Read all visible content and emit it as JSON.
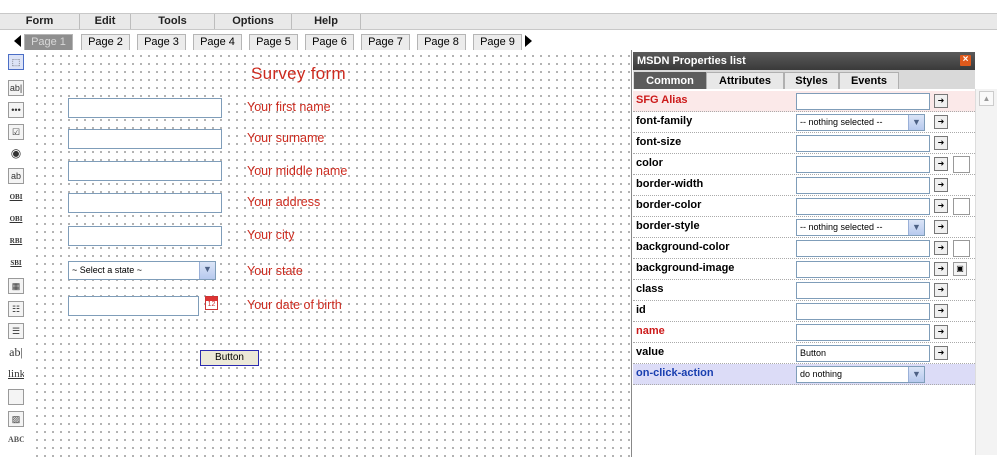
{
  "menu": [
    "Form",
    "Edit",
    "Tools",
    "Options",
    "Help"
  ],
  "pages": {
    "tabs": [
      "Page 1",
      "Page 2",
      "Page 3",
      "Page 4",
      "Page 5",
      "Page 6",
      "Page 7",
      "Page 8",
      "Page 9"
    ],
    "active": "Page 1"
  },
  "toolbox": {
    "icons": [
      "pointer-icon",
      "textbox-icon",
      "password-icon",
      "checkbox-icon",
      "radio-icon",
      "label-icon",
      "option-list-icon-1",
      "option-list-icon-2",
      "radio-list-icon",
      "select-list-icon",
      "table-icon",
      "listbox-icon",
      "listbox-icon-2",
      "label-text-icon",
      "link-icon",
      "panel-icon",
      "image-icon",
      "spell-check-icon"
    ],
    "labels": {
      "textbox": "ab|",
      "password": "•••",
      "opt1": "OBI",
      "opt2": "OBI",
      "rbi": "RBI",
      "sbi": "SBI",
      "ab": "ab|",
      "link": "link",
      "abc": "ABC"
    }
  },
  "form": {
    "title": "Survey form",
    "fields": [
      {
        "label": "Your first name",
        "type": "text"
      },
      {
        "label": "Your surname",
        "type": "text"
      },
      {
        "label": "Your middle name",
        "type": "text"
      },
      {
        "label": "Your address",
        "type": "text"
      },
      {
        "label": "Your city",
        "type": "text"
      },
      {
        "label": "Your state",
        "type": "select",
        "value": "~ Select a state ~"
      },
      {
        "label": "Your date of birth",
        "type": "date"
      }
    ],
    "button_label": "Button"
  },
  "panel": {
    "title": "MSDN Properties list",
    "close": "×",
    "tabs": [
      "Common",
      "Attributes",
      "Styles",
      "Events"
    ],
    "active_tab": "Common",
    "properties": [
      {
        "name": "SFG Alias",
        "type": "input",
        "value": "",
        "color": "#cc1a1a",
        "bg": "#fbe9e9"
      },
      {
        "name": "font-family",
        "type": "select",
        "value": "-- nothing selected --"
      },
      {
        "name": "font-size",
        "type": "input",
        "value": ""
      },
      {
        "name": "color",
        "type": "input",
        "value": "",
        "swatch": true
      },
      {
        "name": "border-width",
        "type": "input",
        "value": ""
      },
      {
        "name": "border-color",
        "type": "input",
        "value": "",
        "swatch": true
      },
      {
        "name": "border-style",
        "type": "select",
        "value": "-- nothing selected --"
      },
      {
        "name": "background-color",
        "type": "input",
        "value": "",
        "swatch": true
      },
      {
        "name": "background-image",
        "type": "input",
        "value": "",
        "image_button": true
      },
      {
        "name": "class",
        "type": "input",
        "value": ""
      },
      {
        "name": "id",
        "type": "input",
        "value": ""
      },
      {
        "name": "name",
        "type": "input",
        "value": "",
        "color": "#cc1a1a"
      },
      {
        "name": "value",
        "type": "input",
        "value": "Button"
      },
      {
        "name": "on-click-action",
        "type": "select",
        "value": "do nothing",
        "color": "#1a3fb0",
        "bg": "#dcdcf7",
        "no_button": true
      }
    ]
  },
  "colors": {
    "accent_red": "#cc2a1e",
    "panel_header": "#4a4a4a"
  }
}
